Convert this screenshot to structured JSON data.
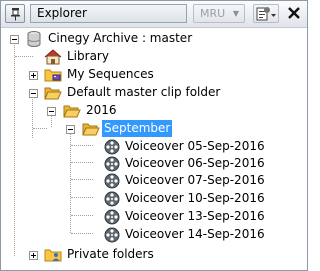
{
  "toolbar": {
    "title": "Explorer",
    "mru_label": "MRU",
    "icons": {
      "pin": "pin-icon",
      "menu": "properties-menu-icon",
      "close": "close-icon"
    }
  },
  "tree": {
    "root": "Cinegy Archive : master",
    "library": "Library",
    "my_sequences": "My Sequences",
    "default_folder": "Default master clip folder",
    "year": "2016",
    "month": "September",
    "clips": [
      "Voiceover 05-Sep-2016",
      "Voiceover 06-Sep-2016",
      "Voiceover 07-Sep-2016",
      "Voiceover 10-Sep-2016",
      "Voiceover 13-Sep-2016",
      "Voiceover 14-Sep-2016"
    ],
    "private_folders": "Private folders"
  }
}
